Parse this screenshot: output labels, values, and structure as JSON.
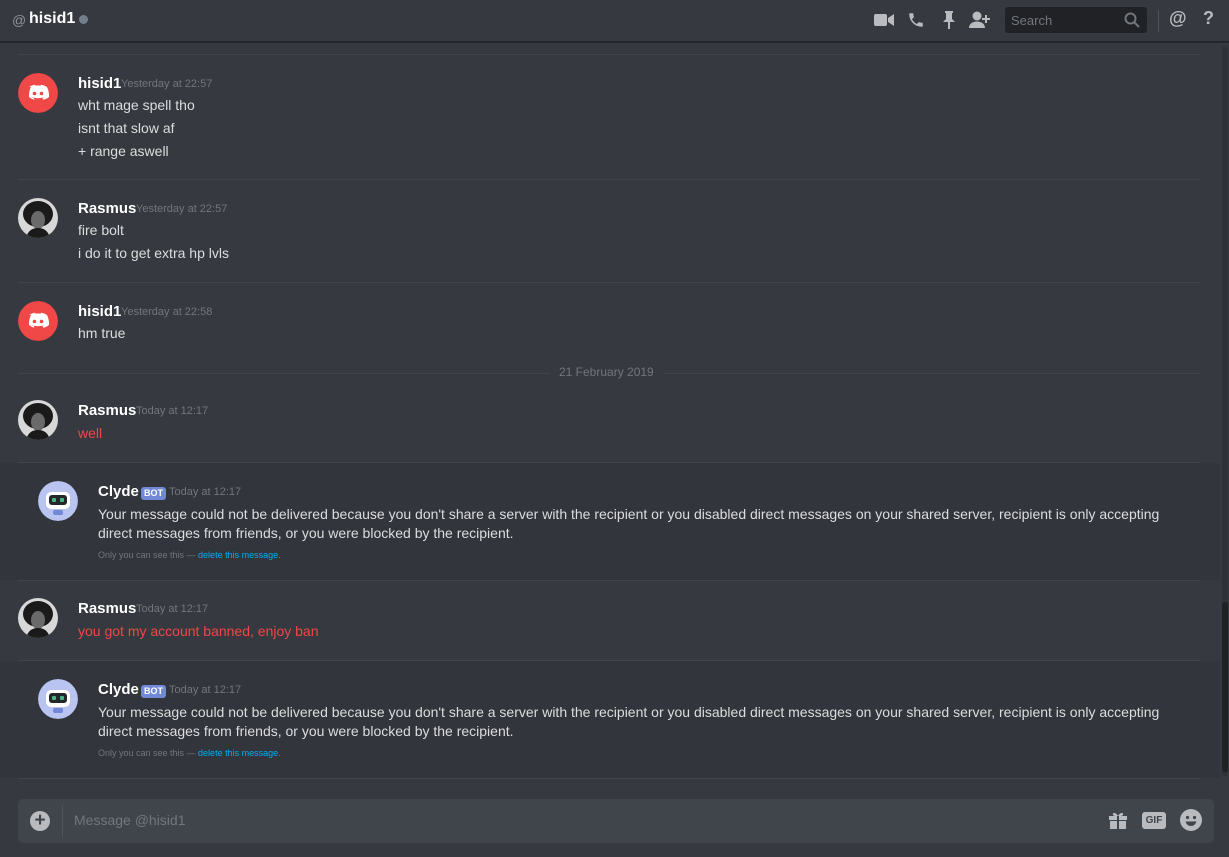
{
  "header": {
    "at_symbol": "@",
    "recipient": "hisid1",
    "search_placeholder": "Search",
    "mentions_glyph": "@",
    "help_glyph": "?",
    "icons": [
      "video-call-icon",
      "voice-call-icon",
      "pin-icon",
      "add-friend-icon",
      "search-icon",
      "mentions-icon",
      "help-icon"
    ]
  },
  "colors": {
    "background": "#36393f",
    "bot_badge": "#7289da",
    "error_text": "#f04747",
    "link": "#00b0f4",
    "discord_avatar": "#f04747"
  },
  "messages": [
    {
      "author": "hisid1",
      "timestamp": "Yesterday at 22:57",
      "avatar": "discord-logo-red",
      "lines": [
        "wht mage spell tho",
        "isnt that slow af",
        "+ range aswell"
      ]
    },
    {
      "author": "Rasmus",
      "timestamp": "Yesterday at 22:57",
      "avatar": "photo",
      "lines": [
        "fire bolt",
        "i do it to get extra hp lvls"
      ]
    },
    {
      "author": "hisid1",
      "timestamp": "Yesterday at 22:58",
      "avatar": "discord-logo-red",
      "lines": [
        "hm true"
      ]
    },
    {
      "author": "Rasmus",
      "timestamp": "Today at 12:17",
      "avatar": "photo",
      "lines": [
        "well"
      ],
      "failed": true
    },
    {
      "author": "Clyde",
      "badge": "BOT",
      "timestamp": "Today at 12:17",
      "avatar": "clyde",
      "text": "Your message could not be delivered because you don't share a server with the recipient or you disabled direct messages on your shared server, recipient is only accepting direct messages from friends, or you were blocked by the recipient.",
      "note_prefix": "Only you can see this — ",
      "note_link": "delete this message."
    },
    {
      "author": "Rasmus",
      "timestamp": "Today at 12:17",
      "avatar": "photo",
      "lines": [
        "you got my account banned, enjoy ban"
      ],
      "failed": true
    },
    {
      "author": "Clyde",
      "badge": "BOT",
      "timestamp": "Today at 12:17",
      "avatar": "clyde",
      "text": "Your message could not be delivered because you don't share a server with the recipient or you disabled direct messages on your shared server, recipient is only accepting direct messages from friends, or you were blocked by the recipient.",
      "note_prefix": "Only you can see this — ",
      "note_link": "delete this message."
    }
  ],
  "date_separator": "21 February 2019",
  "composer": {
    "placeholder": "Message @hisid1",
    "plus": "+",
    "gif_label": "GIF"
  }
}
